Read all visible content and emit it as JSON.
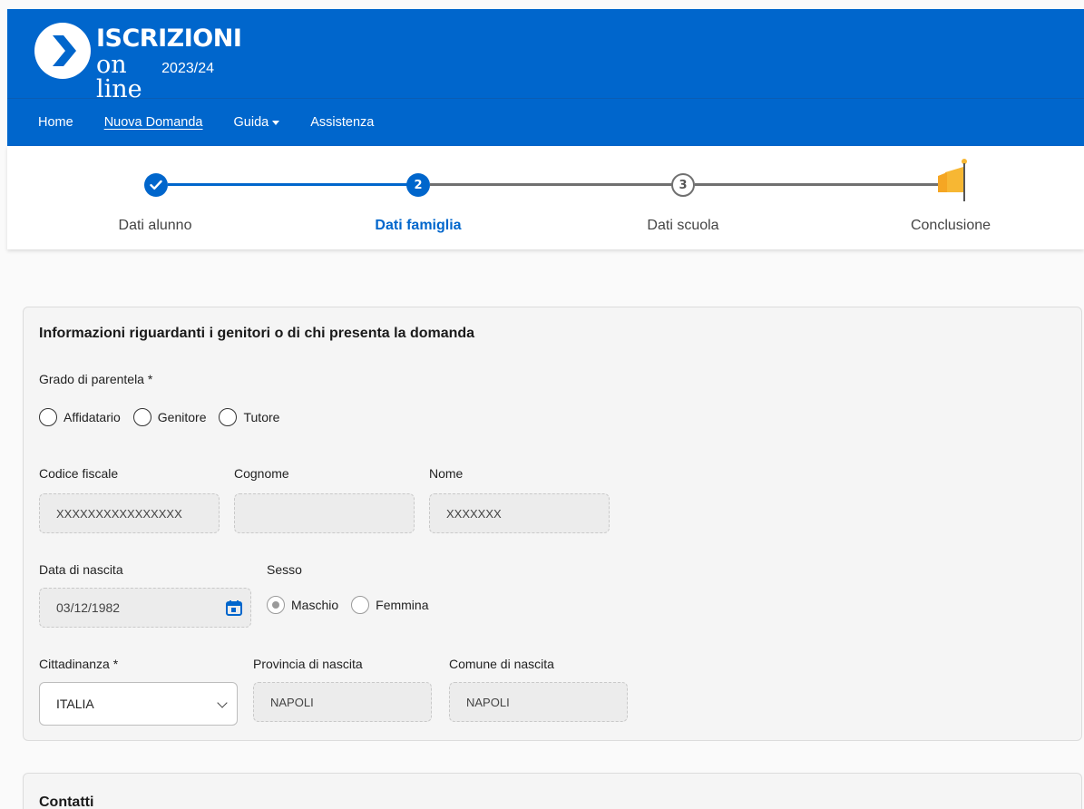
{
  "header": {
    "logo_line1": "ISCRIZIONI",
    "logo_line2": "on line",
    "logo_year": "2023/24"
  },
  "nav": {
    "items": [
      {
        "label": "Home"
      },
      {
        "label": "Nuova Domanda"
      },
      {
        "label": "Guida"
      },
      {
        "label": "Assistenza"
      }
    ]
  },
  "stepper": {
    "steps": [
      {
        "label": "Dati alunno",
        "status": "done"
      },
      {
        "label": "Dati famiglia",
        "number": "2",
        "status": "current"
      },
      {
        "label": "Dati scuola",
        "number": "3",
        "status": "pending"
      },
      {
        "label": "Conclusione",
        "status": "final"
      }
    ],
    "colors": {
      "active": "#0066cc",
      "pending": "#707070",
      "flag": "#f7b733"
    }
  },
  "parents_card": {
    "title": "Informazioni riguardanti i genitori o di chi presenta la domanda",
    "relationship": {
      "label": "Grado di parentela *",
      "options": [
        "Affidatario",
        "Genitore",
        "Tutore"
      ]
    },
    "codice_fiscale": {
      "label": "Codice fiscale",
      "value": "XXXXXXXXXXXXXXXX"
    },
    "cognome": {
      "label": "Cognome",
      "value": ""
    },
    "nome": {
      "label": "Nome",
      "value": "XXXXXXX"
    },
    "birth_date": {
      "label": "Data di nascita",
      "value": "03/12/1982"
    },
    "sex": {
      "label": "Sesso",
      "options": [
        "Maschio",
        "Femmina"
      ],
      "selected": "Maschio"
    },
    "citizenship": {
      "label": "Cittadinanza *",
      "value": "ITALIA"
    },
    "birth_province": {
      "label": "Provincia di nascita",
      "value": "NAPOLI"
    },
    "birth_city": {
      "label": "Comune di nascita",
      "value": "NAPOLI"
    }
  },
  "contacts_card": {
    "title": "Contatti"
  }
}
